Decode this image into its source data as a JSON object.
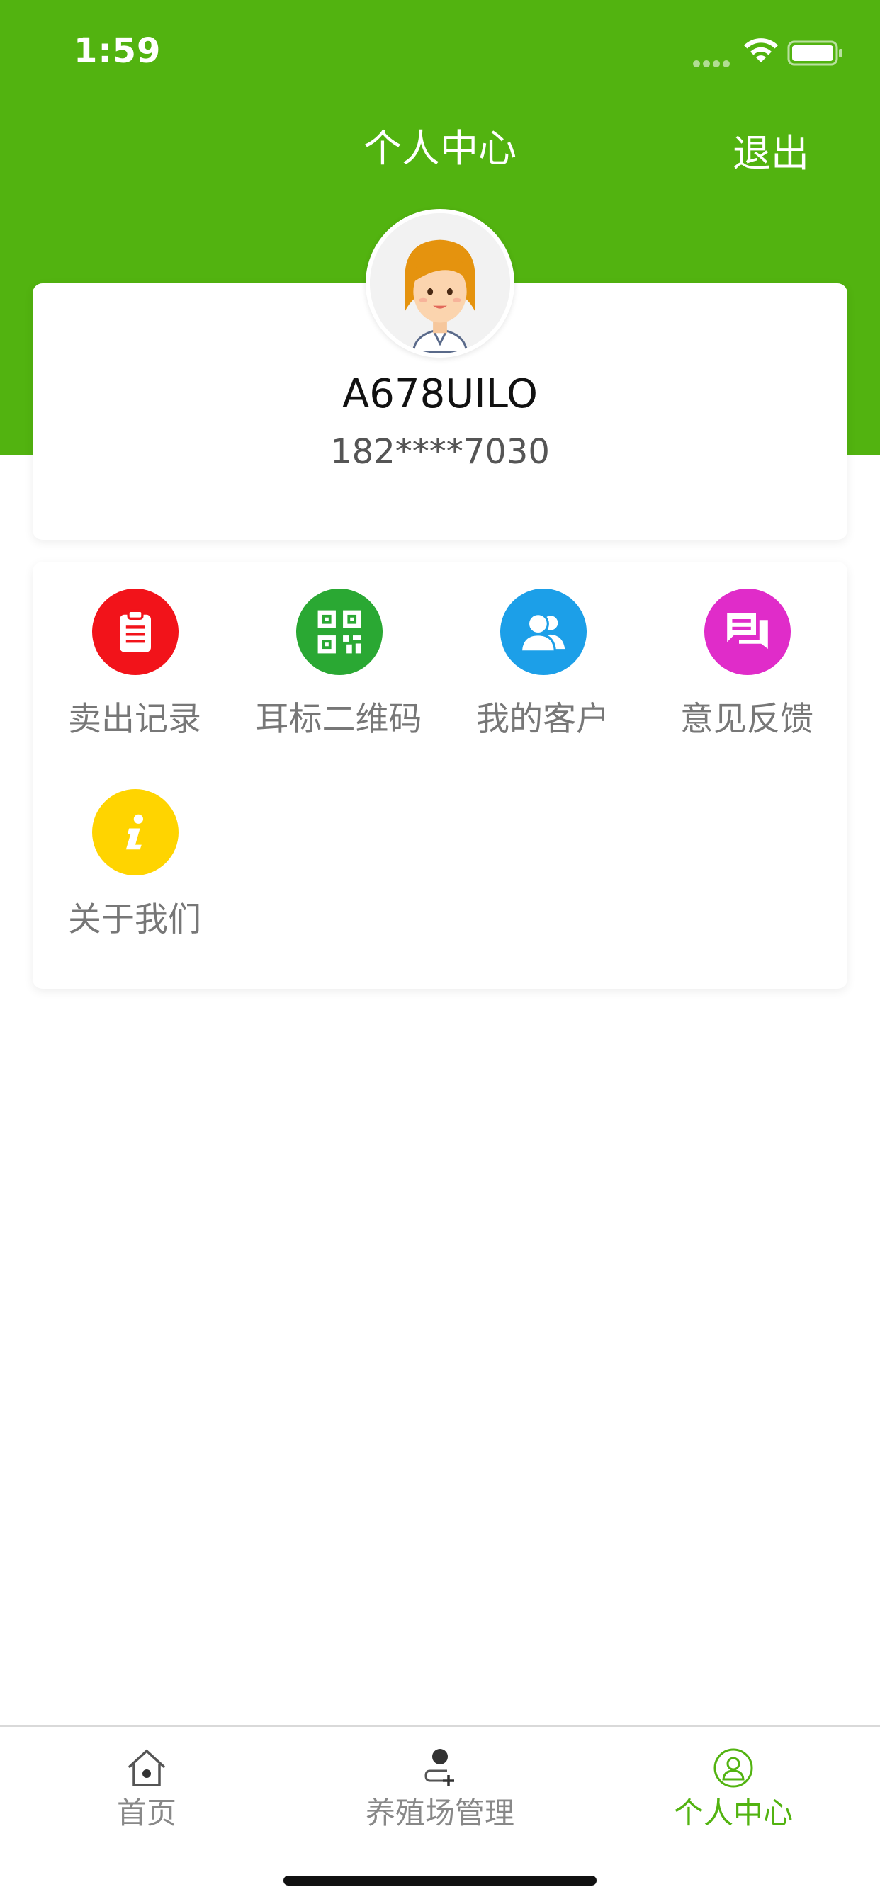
{
  "status_bar": {
    "time": "1:59"
  },
  "header": {
    "title": "个人中心",
    "logout_label": "退出",
    "background_color": "#52B310"
  },
  "profile": {
    "username": "A678UILO",
    "phone": "182****7030"
  },
  "menu": {
    "items": [
      {
        "label": "卖出记录",
        "icon": "clipboard-icon",
        "color": "#F2131A"
      },
      {
        "label": "耳标二维码",
        "icon": "qr-code-icon",
        "color": "#2AA833"
      },
      {
        "label": "我的客户",
        "icon": "users-icon",
        "color": "#1C9FE8"
      },
      {
        "label": "意见反馈",
        "icon": "feedback-icon",
        "color": "#E02CC9"
      },
      {
        "label": "关于我们",
        "icon": "info-icon",
        "color": "#FFD400"
      }
    ]
  },
  "tab_bar": {
    "tabs": [
      {
        "label": "首页",
        "icon": "home-icon"
      },
      {
        "label": "养殖场管理",
        "icon": "farm-management-icon"
      },
      {
        "label": "个人中心",
        "icon": "profile-icon",
        "active": true
      }
    ],
    "active_color": "#52B310"
  }
}
